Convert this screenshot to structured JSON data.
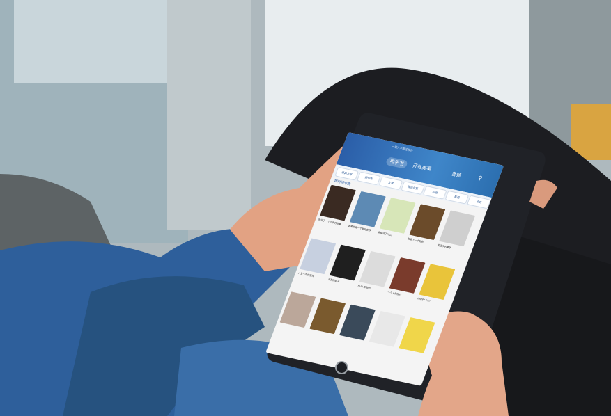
{
  "scene": {
    "description_colors": {
      "wall": "#a9b6bc",
      "window_light": "#e6ecef",
      "sofa": "#5e6466",
      "shirt": "#2d5f9a",
      "pants": "#1b1c20",
      "tablet_frame": "#202227",
      "skin": "#e4a486"
    }
  },
  "app": {
    "header": {
      "small_text": "一笔入不是这样的",
      "tabs": [
        {
          "label": "电子书",
          "active": true
        },
        {
          "label": "开往美渠",
          "active": false
        },
        {
          "label": "音频",
          "active": false
        }
      ]
    },
    "categories": [
      "经典大部",
      "期刊布",
      "文学",
      "精选合集",
      "小说",
      "影视",
      "历史"
    ],
    "sort_label": "按时间分类",
    "rows": [
      [
        {
          "color": "#3a2a22",
          "caption": "他说了一个十年的故事"
        },
        {
          "color": "#5d8ab4",
          "caption": "如果你有一个新的世界"
        },
        {
          "color": "#d7e6b8",
          "caption": "幸福说了什么"
        },
        {
          "color": "#6b4b2a",
          "caption": "知道下一个世界"
        },
        {
          "color": "#cfcfcf",
          "caption": "生活中的美学"
        }
      ],
      [
        {
          "color": "#c7d0e0",
          "caption": "人生一世的冒险"
        },
        {
          "color": "#1f1f1f",
          "caption": "不死的影子"
        },
        {
          "color": "#dcdcdc",
          "caption": "RUN 奔跑吧"
        },
        {
          "color": "#7a3b2c",
          "caption": "一个人的旅行"
        },
        {
          "color": "#e9c43a",
          "caption": "HAPPY DAY"
        }
      ],
      [
        {
          "color": "#bba79a",
          "caption": ""
        },
        {
          "color": "#7a5a2e",
          "caption": ""
        },
        {
          "color": "#3a4a5a",
          "caption": ""
        },
        {
          "color": "#e8e8e8",
          "caption": ""
        },
        {
          "color": "#f0d64a",
          "caption": ""
        }
      ]
    ]
  }
}
